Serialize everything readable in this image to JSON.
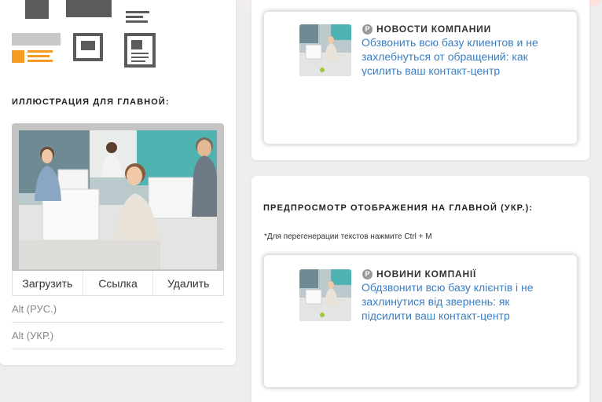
{
  "left": {
    "illustration_title": "ИЛЛЮСТРАЦИЯ ДЛЯ ГЛАВНОЙ:",
    "image_buttons": {
      "upload": "Загрузить",
      "link": "Ссылка",
      "delete": "Удалить"
    },
    "alt_ru_placeholder": "Alt (РУС.)",
    "alt_uk_placeholder": "Alt (УКР.)"
  },
  "preview_ru": {
    "badge": "P",
    "label": "НОВОСТИ КОМПАНИИ",
    "text": "Обзвонить всю базу клиентов и не захлебнуться от обращений: как усилить ваш контакт-центр"
  },
  "preview_uk": {
    "title": "ПРЕДПРОСМОТР ОТОБРАЖЕНИЯ НА ГЛАВНОЙ (УКР.):",
    "note": "*Для перегенерации текстов нажмите Ctrl + M",
    "badge": "P",
    "label": "НОВИНИ КОМПАНІЇ",
    "text": "Обдзвонити всю базу клієнтів і не захлинутися від звернень: як підсилити ваш контакт-центр"
  },
  "colors": {
    "accent_orange": "#f59a23",
    "link_blue": "#3a7fc4"
  }
}
